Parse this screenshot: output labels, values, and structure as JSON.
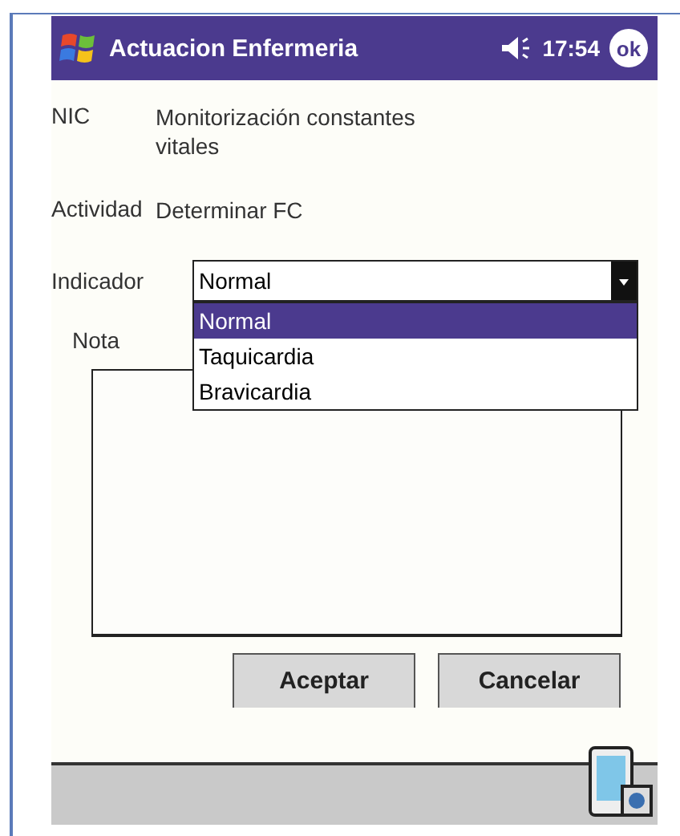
{
  "title_bar": {
    "title": "Actuacion Enfermeria",
    "time": "17:54",
    "ok": "ok"
  },
  "fields": [
    {
      "label": "NIC",
      "value": "Monitorización constantes vitales"
    },
    {
      "label": "Actividad",
      "value": "Determinar FC"
    }
  ],
  "indicator": {
    "label": "Indicador",
    "value": "Normal",
    "options": [
      {
        "label": "Normal",
        "selected": true
      },
      {
        "label": "Taquicardia",
        "selected": false
      },
      {
        "label": "Bravicardia",
        "selected": false
      }
    ]
  },
  "note": {
    "label": "Nota"
  },
  "buttons": [
    "Aceptar",
    "Cancelar"
  ]
}
